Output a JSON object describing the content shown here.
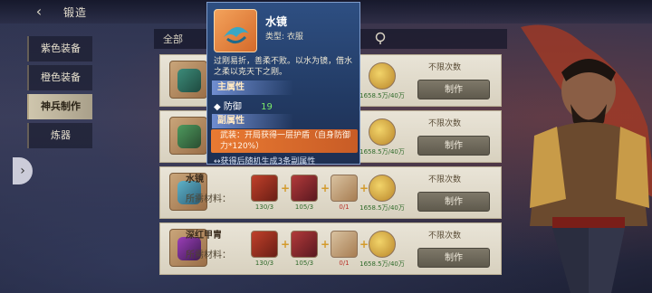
{
  "header": {
    "title": "锻造",
    "back_glyph": "‹"
  },
  "nav": {
    "items": [
      {
        "label": "紫色装备",
        "active": false
      },
      {
        "label": "橙色装备",
        "active": false
      },
      {
        "label": "神兵制作",
        "active": true
      },
      {
        "label": "炼器",
        "active": false
      }
    ],
    "expand_glyph": "›"
  },
  "filter": {
    "all_label": "全部",
    "icon": "ring-icon"
  },
  "tooltip": {
    "name": "水镜",
    "type_label": "类型: 衣服",
    "description": "过刚易折，善柔不败。以水为镜，借水之柔以克天下之刚。",
    "main_attr_title": "主属性",
    "main_stat_name": "防御",
    "main_stat_value": "19",
    "sub_attr_title": "副属性",
    "sub_attr_text": "武装：开局获得一层护盾（自身防御力*120%）",
    "note": "↔获得后随机生成3条副属性"
  },
  "recipes": [
    {
      "name": "",
      "material_label": "",
      "limit": "不限次数",
      "button": "制作",
      "counts": [
        "",
        "",
        "",
        "1658.5万/40万"
      ]
    },
    {
      "name": "",
      "material_label": "",
      "limit": "不限次数",
      "button": "制作",
      "counts": [
        "",
        "",
        "",
        "1658.5万/40万"
      ]
    },
    {
      "name": "水镜",
      "material_label": "所需材料：",
      "limit": "不限次数",
      "button": "制作",
      "counts": [
        "130/3",
        "105/3",
        "0/1",
        "1658.5万/40万"
      ]
    },
    {
      "name": "深红甲胄",
      "material_label": "所需材料：",
      "limit": "不限次数",
      "button": "制作",
      "counts": [
        "130/3",
        "105/3",
        "0/1",
        "1658.5万/40万"
      ]
    }
  ],
  "colors": {
    "tooltip_bg": "#2e4f82",
    "sub_attr_bg": "#e97a32",
    "stat_value": "#7bea6a",
    "nav_active": "#cfc6ad"
  }
}
